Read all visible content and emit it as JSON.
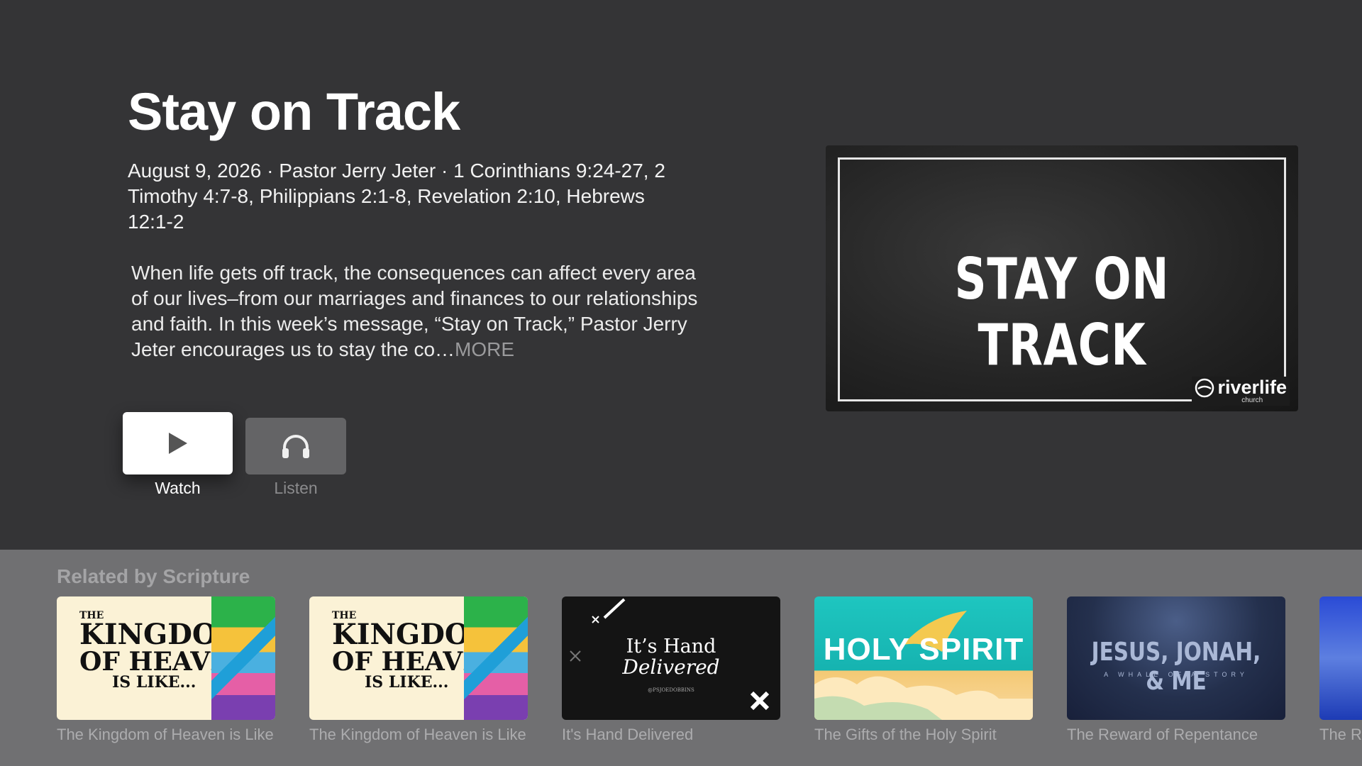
{
  "sermon": {
    "title": "Stay on Track",
    "meta": "August 9, 2026 · Pastor Jerry Jeter · 1 Corinthians 9:24-27, 2 Timothy 4:7-8, Philippians 2:1-8, Revelation 2:10, Hebrews 12:1-2",
    "description": "When life gets off track, the consequences can affect every area of our lives–from our marriages and finances to our relationships and faith. In this week’s message, “Stay on Track,” Pastor Jerry Jeter encourages us to stay the co…",
    "more_label": "MORE"
  },
  "actions": {
    "watch_label": "Watch",
    "listen_label": "Listen"
  },
  "artwork": {
    "title": "STAY ON TRACK",
    "logo_text": "riverlife",
    "logo_sub": "church"
  },
  "related": {
    "heading": "Related by Scripture",
    "items": [
      {
        "caption": "The Kingdom of Heaven is Like…",
        "art_line1": "THE",
        "art_line2": "KINGDOM",
        "art_line3": "OF HEAVEN",
        "art_line4": "IS LIKE..."
      },
      {
        "caption": "The Kingdom of Heaven is Like…",
        "art_line1": "THE",
        "art_line2": "KINGDOM",
        "art_line3": "OF HEAVEN",
        "art_line4": "IS LIKE..."
      },
      {
        "caption": "It's Hand Delivered",
        "art_line1": "It’s Hand",
        "art_line2": "Delivered",
        "art_line3": "@PSJOEDOBBINS"
      },
      {
        "caption": "The Gifts of the Holy Spirit",
        "art_line1": "HOLY SPIRIT"
      },
      {
        "caption": "The Reward of Repentance",
        "art_line1": "JESUS, JONAH, & ME",
        "art_line2": "A WHALE OF A STORY"
      },
      {
        "caption": "The R"
      }
    ]
  },
  "colors": {
    "background": "#343436",
    "shelf": "#707072",
    "watch_button": "#ffffff",
    "listen_button": "#646466"
  }
}
